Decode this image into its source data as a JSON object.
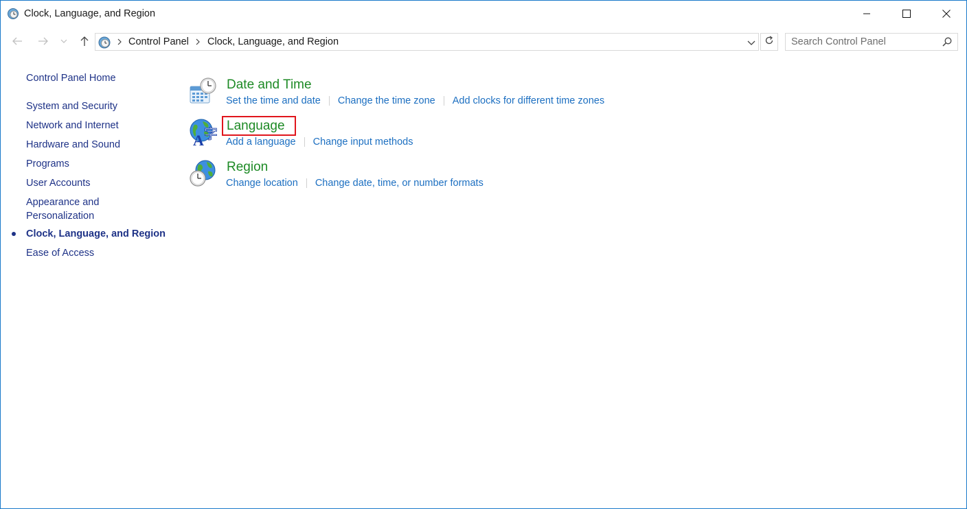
{
  "window": {
    "title": "Clock, Language, and Region"
  },
  "address_bar": {
    "breadcrumbs": [
      "Control Panel",
      "Clock, Language, and Region"
    ]
  },
  "search": {
    "placeholder": "Search Control Panel"
  },
  "sidebar": {
    "home": "Control Panel Home",
    "items": [
      {
        "label": "System and Security"
      },
      {
        "label": "Network and Internet"
      },
      {
        "label": "Hardware and Sound"
      },
      {
        "label": "Programs"
      },
      {
        "label": "User Accounts"
      },
      {
        "label": "Appearance and"
      },
      {
        "label": "Personalization"
      },
      {
        "label": "Clock, Language, and Region",
        "current": true
      },
      {
        "label": "Ease of Access"
      }
    ]
  },
  "categories": [
    {
      "title": "Date and Time",
      "icon": "date-time-icon",
      "links": [
        "Set the time and date",
        "Change the time zone",
        "Add clocks for different time zones"
      ]
    },
    {
      "title": "Language",
      "icon": "language-globe-icon",
      "links": [
        "Add a language",
        "Change input methods"
      ]
    },
    {
      "title": "Region",
      "icon": "region-globe-clock-icon",
      "links": [
        "Change location",
        "Change date, time, or number formats"
      ]
    }
  ],
  "colors": {
    "category_title": "#1d8a25",
    "task_link": "#1c6fc1",
    "sidebar_link": "#1e3287",
    "highlight_box": "#e0151c",
    "window_border": "#1979ca"
  }
}
